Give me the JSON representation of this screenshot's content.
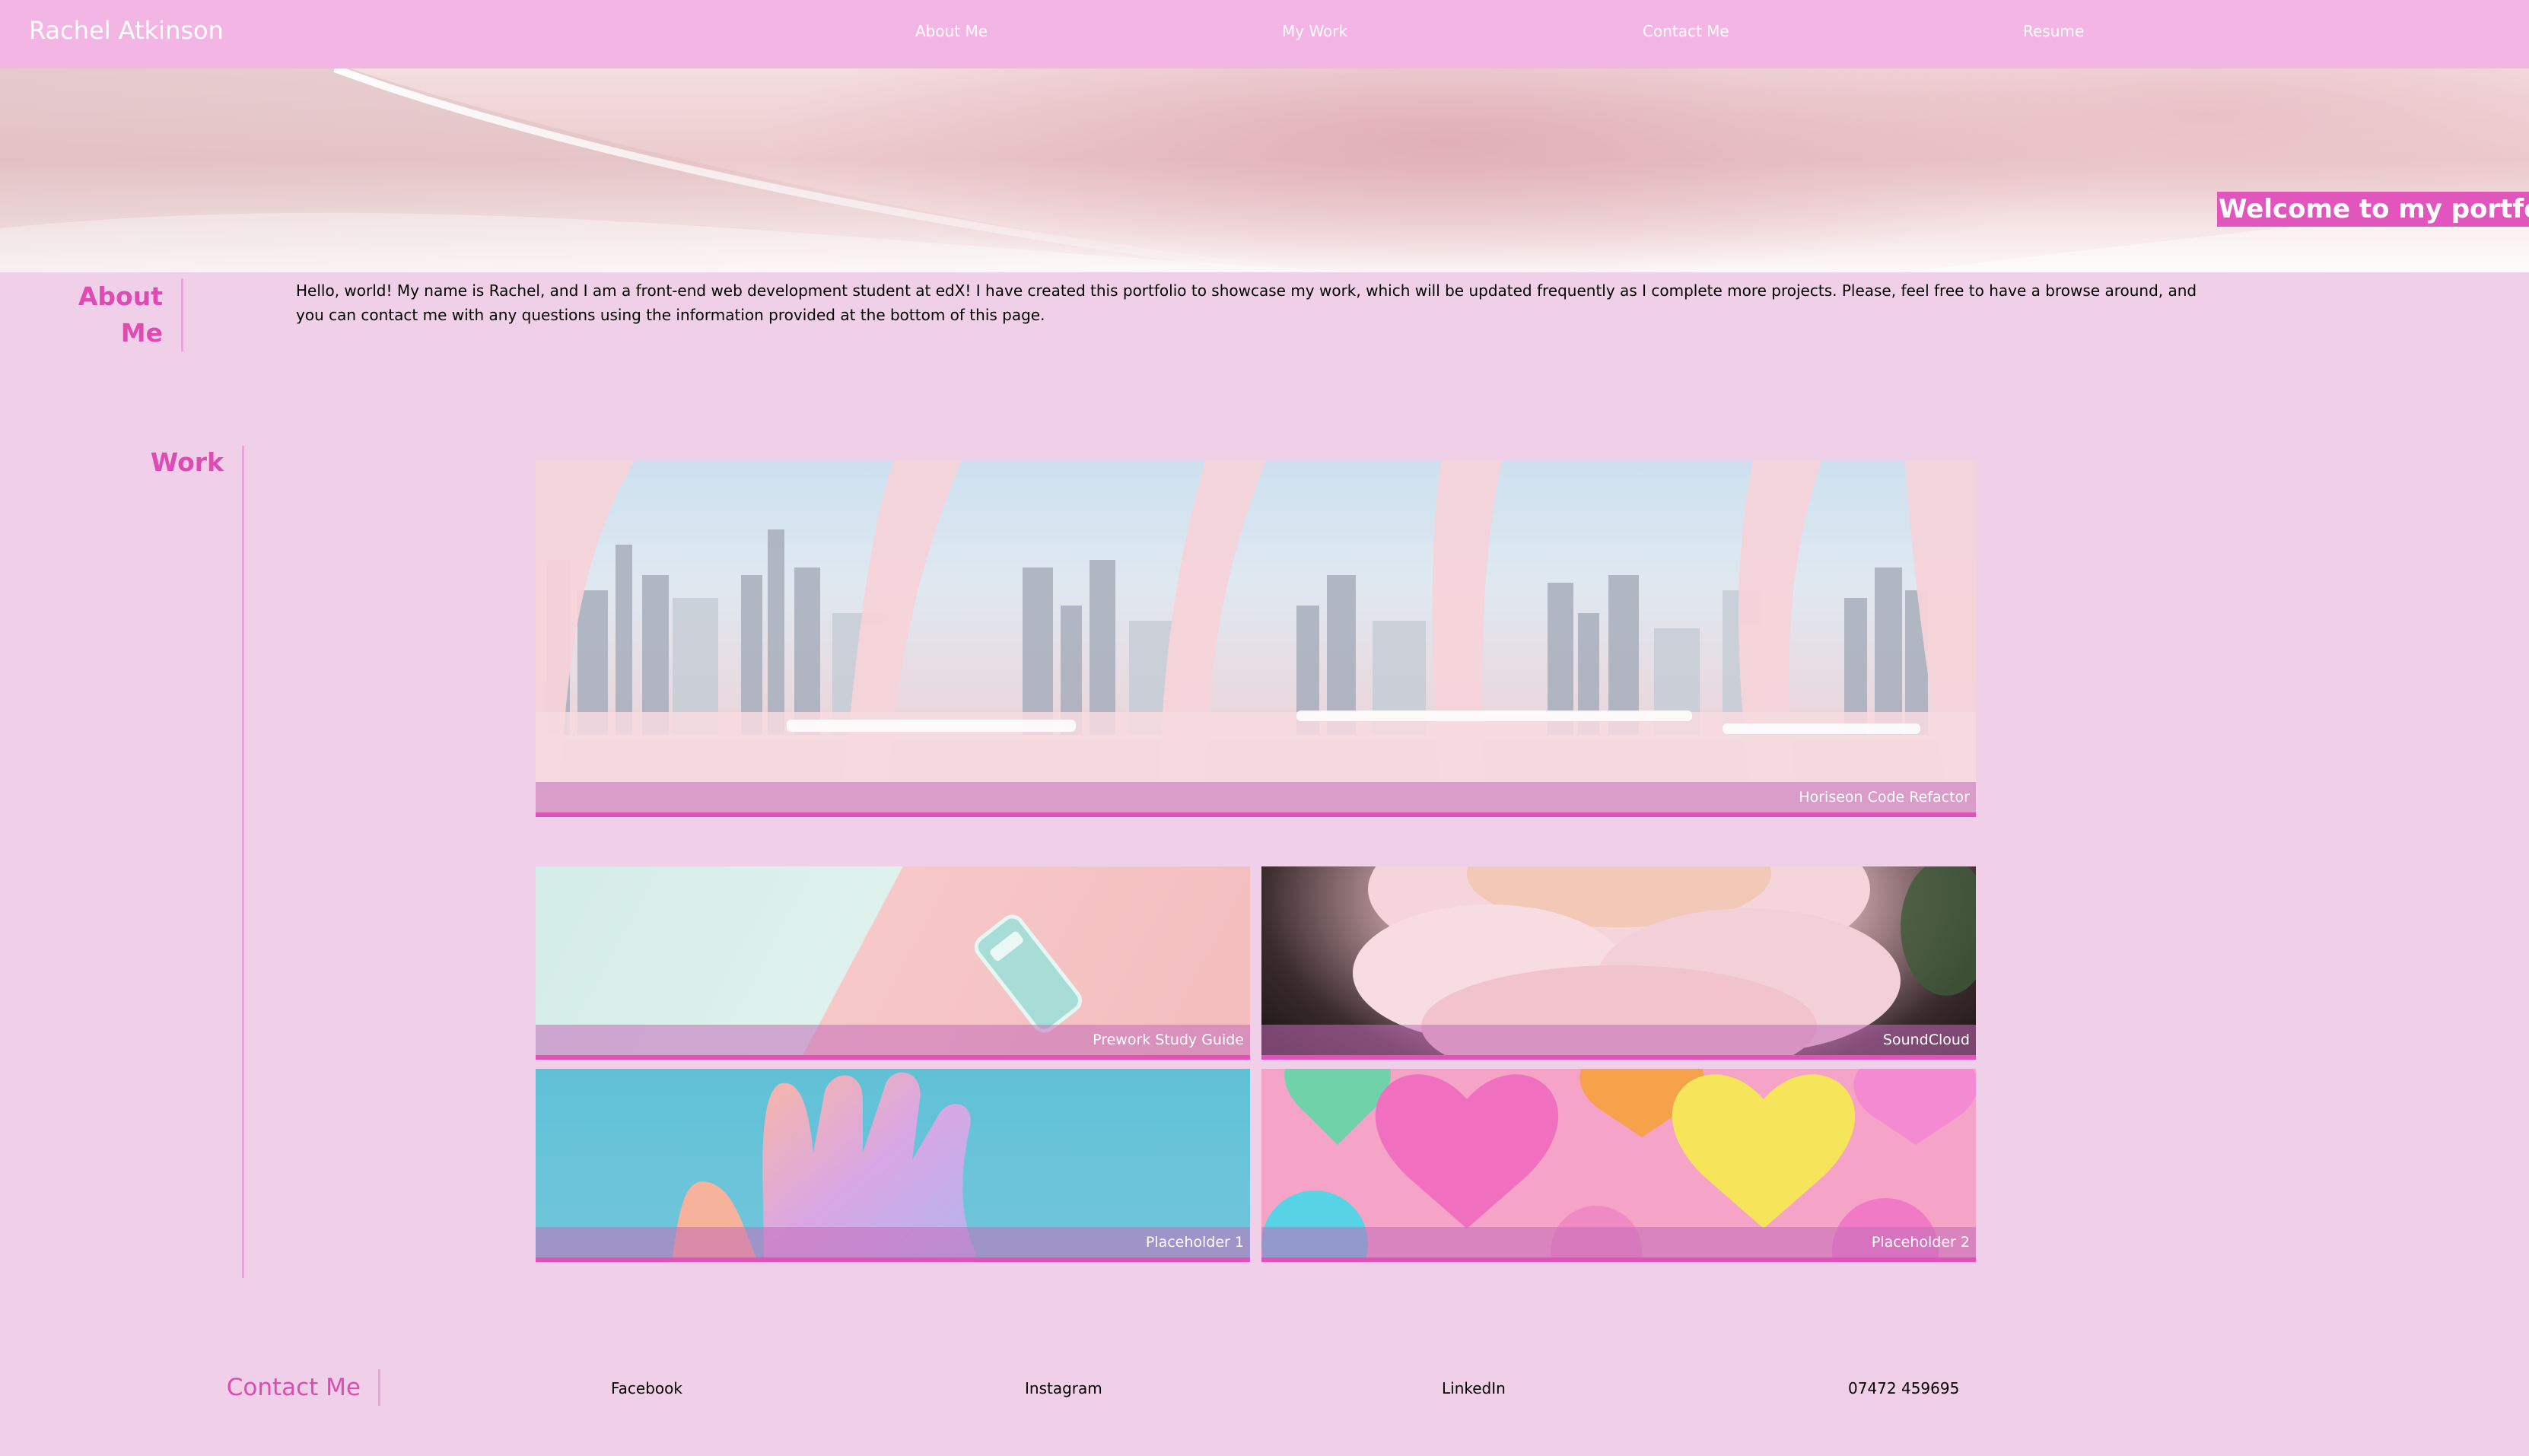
{
  "header": {
    "site_title": "Rachel Atkinson",
    "nav": [
      {
        "label": "About Me"
      },
      {
        "label": "My Work"
      },
      {
        "label": "Contact Me"
      },
      {
        "label": "Resume"
      }
    ]
  },
  "hero": {
    "welcome": "Welcome to my portfolio!"
  },
  "about": {
    "heading": "About Me",
    "text": "Hello, world! My name is Rachel, and I am a front-end web development student at edX! I have created this portfolio to showcase my work, which will be updated frequently as I complete more projects. Please, feel free to have a browse around, and you can contact me with any questions using the information provided at the bottom of this page."
  },
  "work": {
    "heading": "Work",
    "projects": [
      {
        "title": "Horiseon Code Refactor"
      },
      {
        "title": "Prework Study Guide"
      },
      {
        "title": "SoundCloud"
      },
      {
        "title": "Placeholder 1"
      },
      {
        "title": "Placeholder 2"
      }
    ]
  },
  "contact": {
    "heading": "Contact Me",
    "links": [
      {
        "label": "Facebook"
      },
      {
        "label": "Instagram"
      },
      {
        "label": "LinkedIn"
      },
      {
        "label": "07472 459695"
      }
    ]
  },
  "colors": {
    "header_bg": "#f3b5e4",
    "page_bg": "#f0d0e8",
    "accent": "#e04ab3",
    "welcome_bg": "#e255bc"
  }
}
